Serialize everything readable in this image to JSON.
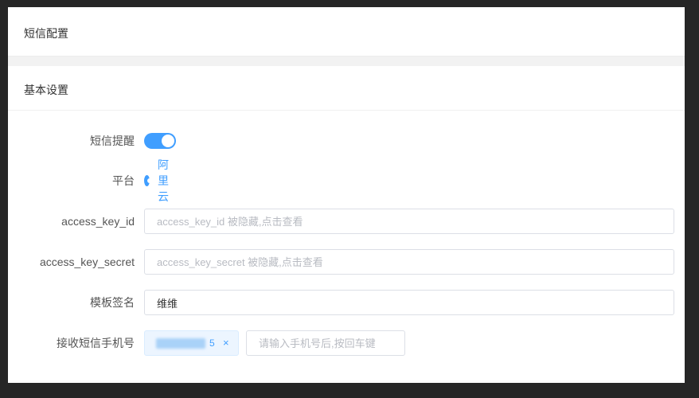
{
  "header": {
    "title": "短信配置"
  },
  "section": {
    "title": "基本设置"
  },
  "form": {
    "sms_alert": {
      "label": "短信提醒",
      "enabled": true
    },
    "platform": {
      "label": "平台",
      "option": "阿里云"
    },
    "access_key_id": {
      "label": "access_key_id",
      "placeholder": "access_key_id 被隐藏,点击查看",
      "value": ""
    },
    "access_key_secret": {
      "label": "access_key_secret",
      "placeholder": "access_key_secret 被隐藏,点击查看",
      "value": ""
    },
    "template_sign": {
      "label": "模板签名",
      "value": "维维"
    },
    "receive_phones": {
      "label": "接收短信手机号",
      "tags": [
        {
          "text": "5",
          "close": "×"
        }
      ],
      "placeholder": "请输入手机号后,按回车键"
    }
  },
  "colors": {
    "accent": "#409eff",
    "tag_bg": "#ecf5ff"
  },
  "icons": {
    "tag_close": "close-icon",
    "radio": "radio-checked-icon"
  }
}
